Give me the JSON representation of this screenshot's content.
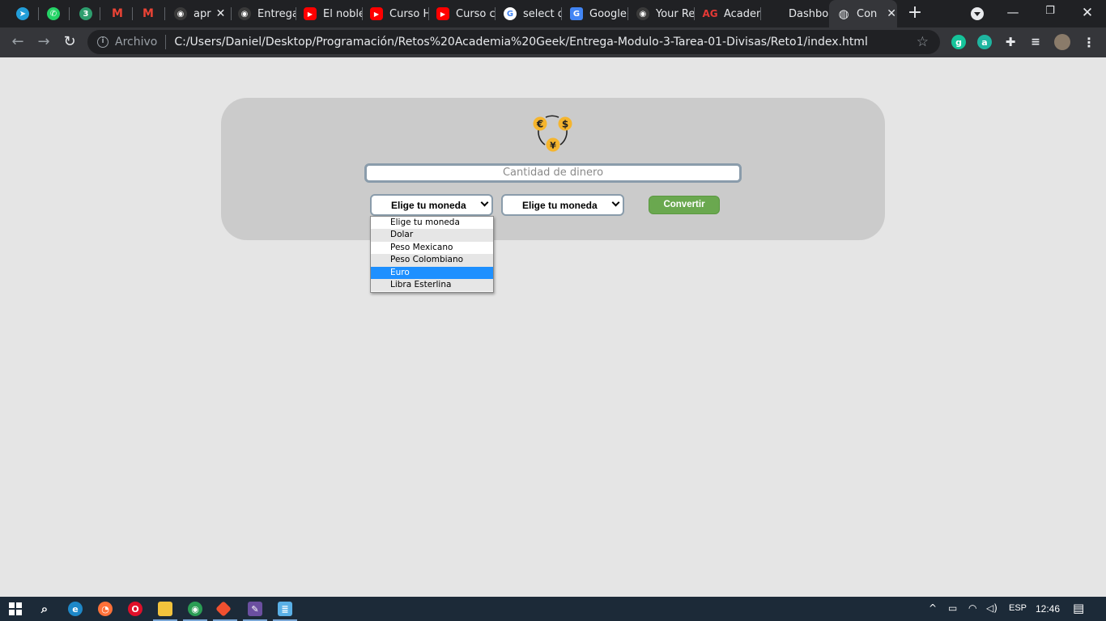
{
  "browser": {
    "tabs": [
      {
        "title": "",
        "icon": "telegram-icon",
        "color": "#229ed9",
        "glyph": "➤"
      },
      {
        "title": "",
        "icon": "whatsapp-icon",
        "color": "#25d366",
        "glyph": "✆"
      },
      {
        "title": "",
        "icon": "badge-3-icon",
        "color": "#2e9e6e",
        "glyph": "3"
      },
      {
        "title": "",
        "icon": "gmail-icon",
        "color": "#ea4335",
        "glyph": "M"
      },
      {
        "title": "",
        "icon": "gmail-icon",
        "color": "#ea4335",
        "glyph": "M"
      },
      {
        "title": "apr",
        "icon": "github-icon",
        "color": "#3a3a3a",
        "glyph": "◉"
      },
      {
        "title": "Entrega",
        "icon": "github-icon",
        "color": "#3a3a3a",
        "glyph": "◉"
      },
      {
        "title": "El noble",
        "icon": "youtube-icon",
        "color": "#ff0000",
        "glyph": "▶"
      },
      {
        "title": "Curso H",
        "icon": "youtube-icon",
        "color": "#ff0000",
        "glyph": "▶"
      },
      {
        "title": "Curso c",
        "icon": "youtube-icon",
        "color": "#ff0000",
        "glyph": "▶"
      },
      {
        "title": "select d",
        "icon": "google-icon",
        "color": "#ffffff",
        "glyph": "G"
      },
      {
        "title": "Google",
        "icon": "google-translate-icon",
        "color": "#4285f4",
        "glyph": "G"
      },
      {
        "title": "Your Re",
        "icon": "github-icon",
        "color": "#3a3a3a",
        "glyph": "◉"
      },
      {
        "title": "Academ",
        "icon": "academia-geek-icon",
        "color": "#e53935",
        "glyph": "AG"
      },
      {
        "title": "Dashbo",
        "icon": "",
        "color": "",
        "glyph": ""
      },
      {
        "title": "Con",
        "icon": "globe-icon",
        "color": "#5f6368",
        "glyph": "◍",
        "active": true
      }
    ],
    "address": {
      "security_label": "Archivo",
      "url": "C:/Users/Daniel/Desktop/Programación/Retos%20Academia%20Geek/Entrega-Modulo-3-Tarea-01-Divisas/Reto1/index.html"
    }
  },
  "converter": {
    "amount_placeholder": "Cantidad de dinero",
    "from_select_value": "Elige tu moneda",
    "to_select_value": "Elige tu moneda",
    "convert_label": "Convertir",
    "options": [
      "Elige tu moneda",
      "Dolar",
      "Peso Mexicano",
      "Peso Colombiano",
      "Euro",
      "Libra Esterlina"
    ],
    "highlighted_option": "Euro",
    "logo_symbols": [
      "€",
      "$",
      "¥"
    ],
    "colors": {
      "accent": "#6aa84f",
      "coin": "#f5b52e",
      "highlight": "#1e90ff"
    }
  },
  "taskbar": {
    "language": "ESP",
    "time": "12:46"
  }
}
